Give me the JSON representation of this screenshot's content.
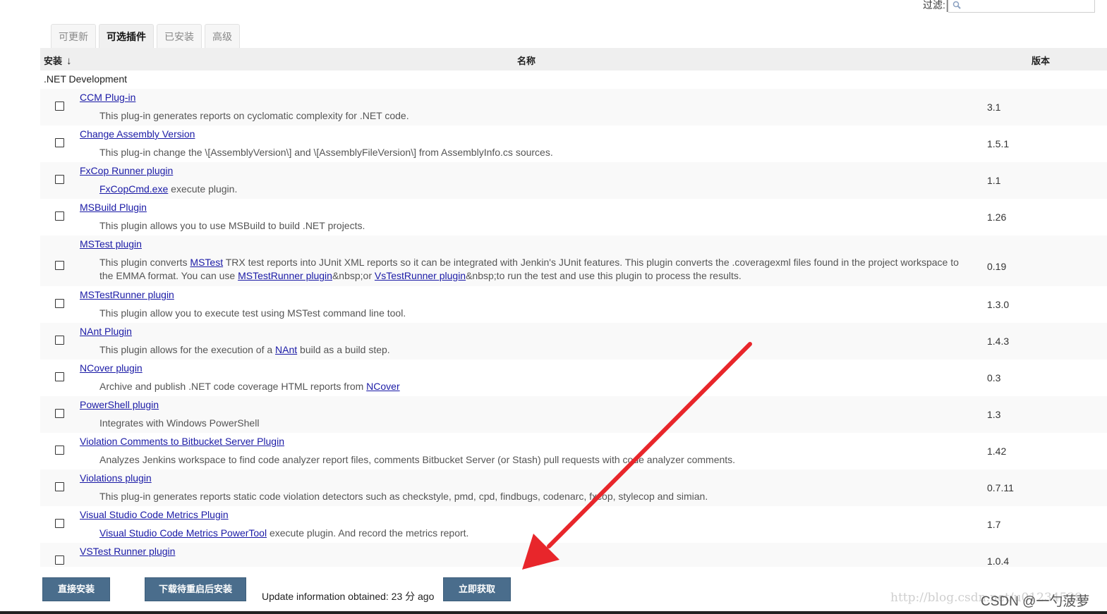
{
  "filter": {
    "label": "过滤:",
    "placeholder": ""
  },
  "tabs": [
    {
      "label": "可更新"
    },
    {
      "label": "可选插件",
      "active": true
    },
    {
      "label": "已安装"
    },
    {
      "label": "高级"
    }
  ],
  "table": {
    "headers": {
      "install": "安装",
      "sort_arrow": "↓",
      "name": "名称",
      "version": "版本"
    },
    "category": ".NET Development"
  },
  "plugins": [
    {
      "name": "CCM Plug-in",
      "desc": [
        [
          "t",
          "This plug-in generates reports on cyclomatic complexity for .NET code."
        ]
      ],
      "version": "3.1"
    },
    {
      "name": "Change Assembly Version",
      "desc": [
        [
          "t",
          "This plug-in change the \\[AssemblyVersion\\] and \\[AssemblyFileVersion\\] from AssemblyInfo.cs sources."
        ]
      ],
      "version": "1.5.1"
    },
    {
      "name": "FxCop Runner plugin",
      "desc": [
        [
          "a",
          "FxCopCmd.exe"
        ],
        [
          "t",
          " execute plugin."
        ]
      ],
      "version": "1.1"
    },
    {
      "name": "MSBuild Plugin",
      "desc": [
        [
          "t",
          "This plugin allows you to use MSBuild to build .NET projects."
        ]
      ],
      "version": "1.26"
    },
    {
      "name": "MSTest plugin",
      "desc": [
        [
          "t",
          "This plugin converts "
        ],
        [
          "a",
          "MSTest"
        ],
        [
          "t",
          " TRX test reports into JUnit XML reports so it can be integrated with Jenkin's JUnit features. This plugin converts the .coveragexml files found in the project workspace to the EMMA format. You can use "
        ],
        [
          "a",
          "MSTestRunner plugin"
        ],
        [
          "t",
          "&nbsp;or "
        ],
        [
          "a",
          "VsTestRunner plugin"
        ],
        [
          "t",
          "&nbsp;to run the test and use this plugin to process the results."
        ]
      ],
      "version": "0.19"
    },
    {
      "name": "MSTestRunner plugin",
      "desc": [
        [
          "t",
          "This plugin allow you to execute test using MSTest command line tool."
        ]
      ],
      "version": "1.3.0"
    },
    {
      "name": "NAnt Plugin",
      "desc": [
        [
          "t",
          "This plugin allows for the execution of a "
        ],
        [
          "a",
          "NAnt"
        ],
        [
          "t",
          " build as a build step."
        ]
      ],
      "version": "1.4.3"
    },
    {
      "name": "NCover plugin",
      "desc": [
        [
          "t",
          "Archive and publish .NET code coverage HTML reports from "
        ],
        [
          "a",
          "NCover"
        ]
      ],
      "version": "0.3"
    },
    {
      "name": "PowerShell plugin",
      "desc": [
        [
          "t",
          "Integrates with Windows PowerShell"
        ]
      ],
      "version": "1.3"
    },
    {
      "name": "Violation Comments to Bitbucket Server Plugin",
      "desc": [
        [
          "t",
          "Analyzes Jenkins workspace to find code analyzer report files, comments Bitbucket Server (or Stash) pull requests with code analyzer comments."
        ]
      ],
      "version": "1.42"
    },
    {
      "name": "Violations plugin",
      "desc": [
        [
          "t",
          "This plug-in generates reports static code violation detectors such as checkstyle, pmd, cpd, findbugs, codenarc, fxcop, stylecop and simian."
        ]
      ],
      "version": "0.7.11"
    },
    {
      "name": "Visual Studio Code Metrics Plugin",
      "desc": [
        [
          "a",
          "Visual Studio Code Metrics PowerTool"
        ],
        [
          "t",
          " execute plugin. And record the metrics report."
        ]
      ],
      "version": "1.7"
    },
    {
      "name": "VSTest Runner plugin",
      "desc": [],
      "version": "1.0.4"
    }
  ],
  "buttons": {
    "install_now": "直接安装",
    "download_restart": "下载待重启后安装",
    "check_now": "立即获取"
  },
  "update_info": "Update information obtained: 23 分 ago",
  "watermark": {
    "url": "http://blog.csdn.net/u01234539",
    "csdn": "CSDN @一勺菠萝"
  },
  "colors": {
    "button": "#4a6d8c",
    "link": "#1a1aa6",
    "arrow": "#e8262b"
  }
}
